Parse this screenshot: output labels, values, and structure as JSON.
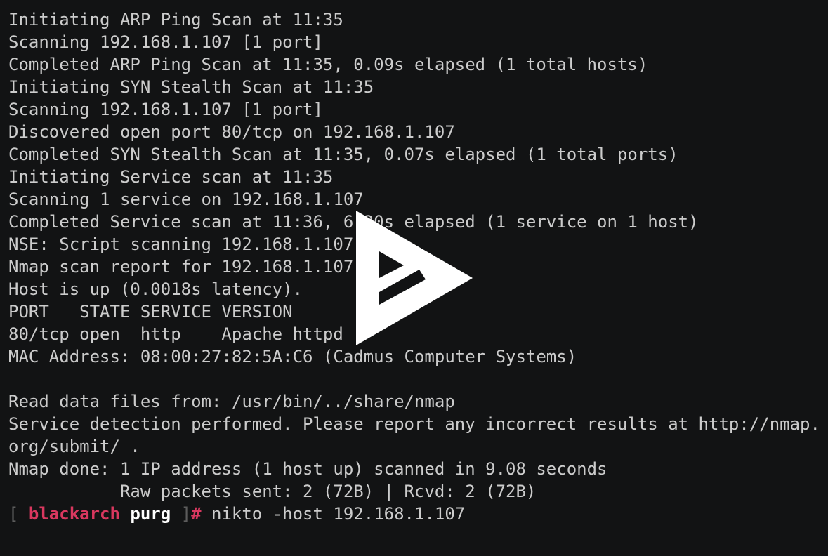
{
  "output_lines": [
    "Initiating ARP Ping Scan at 11:35",
    "Scanning 192.168.1.107 [1 port]",
    "Completed ARP Ping Scan at 11:35, 0.09s elapsed (1 total hosts)",
    "Initiating SYN Stealth Scan at 11:35",
    "Scanning 192.168.1.107 [1 port]",
    "Discovered open port 80/tcp on 192.168.1.107",
    "Completed SYN Stealth Scan at 11:35, 0.07s elapsed (1 total ports)",
    "Initiating Service scan at 11:35",
    "Scanning 1 service on 192.168.1.107",
    "Completed Service scan at 11:36, 6.20s elapsed (1 service on 1 host)",
    "NSE: Script scanning 192.168.1.107",
    "Nmap scan report for 192.168.1.107",
    "Host is up (0.0018s latency).",
    "PORT   STATE SERVICE VERSION",
    "80/tcp open  http    Apache httpd",
    "MAC Address: 08:00:27:82:5A:C6 (Cadmus Computer Systems)",
    "",
    "Read data files from: /usr/bin/../share/nmap",
    "Service detection performed. Please report any incorrect results at http://nmap.",
    "org/submit/ .",
    "Nmap done: 1 IP address (1 host up) scanned in 9.08 seconds",
    "           Raw packets sent: 2 (72B) | Rcvd: 2 (72B)"
  ],
  "prompt": {
    "open_bracket": "[ ",
    "hostname": "blackarch",
    "username": "purg",
    "close_bracket": " ]",
    "symbol": "#",
    "command": " nikto -host 192.168.1.107"
  },
  "overlay": {
    "icon": "asciinema-play-icon"
  },
  "colors": {
    "background": "#121314",
    "text": "#cccccc",
    "accent": "#d9385f",
    "bracket": "#5c5c5c"
  }
}
